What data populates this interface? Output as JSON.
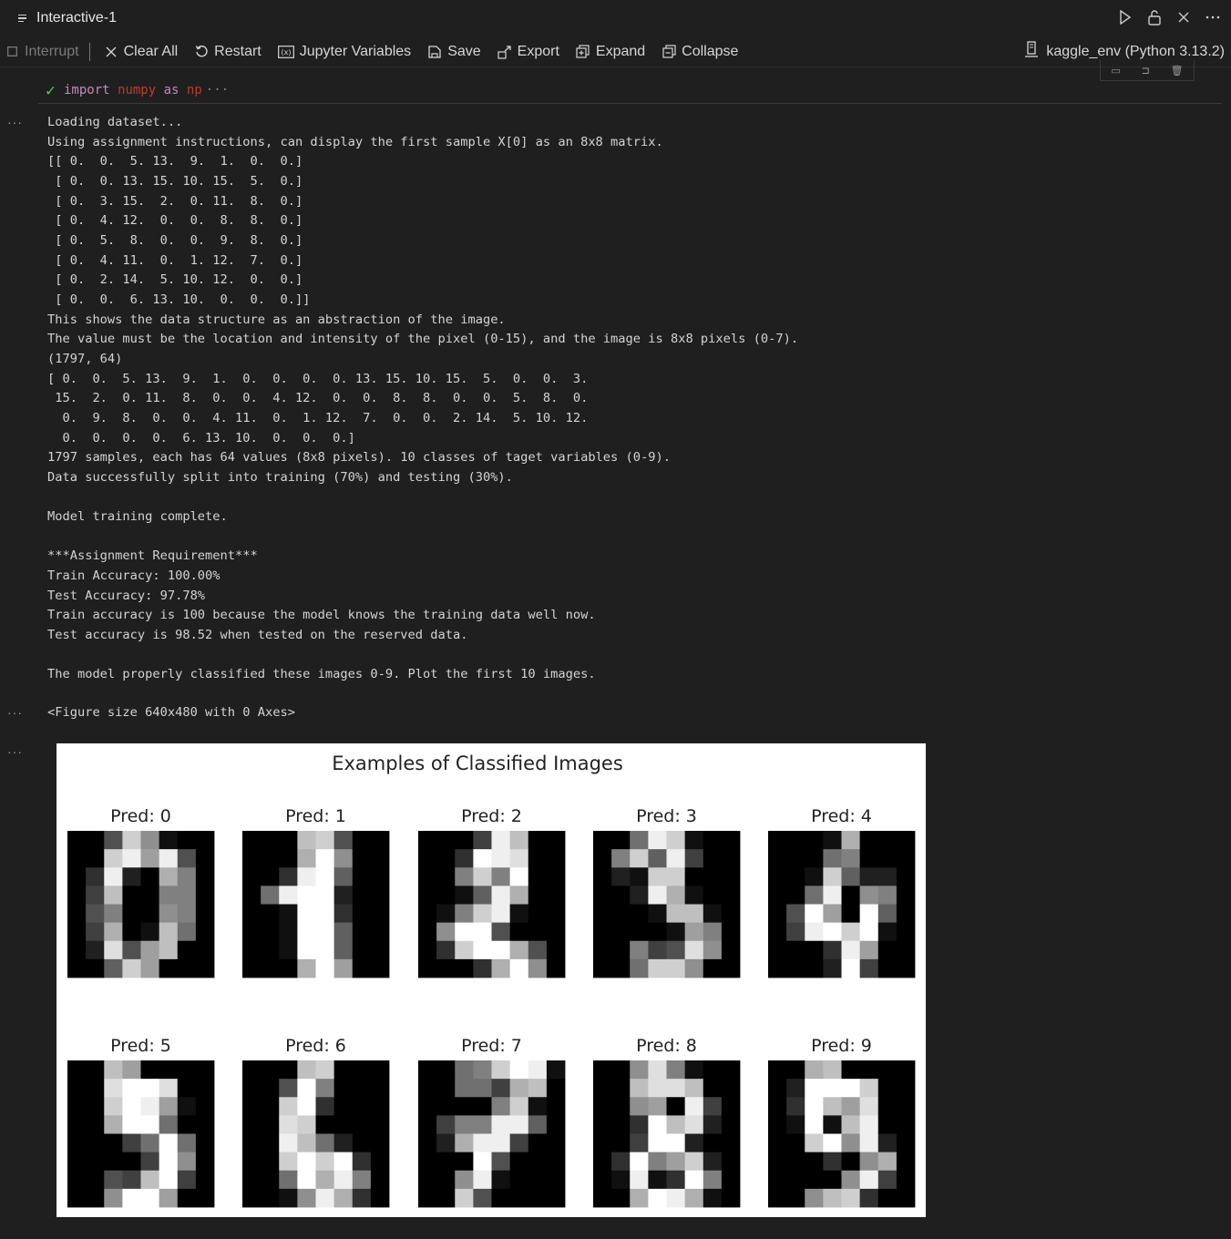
{
  "window": {
    "title": "Interactive-1"
  },
  "title_actions": [
    {
      "name": "run-icon",
      "glyph": "▷"
    },
    {
      "name": "lock-icon",
      "glyph": "🔓"
    },
    {
      "name": "close-icon",
      "glyph": "✕"
    },
    {
      "name": "more-icon",
      "glyph": "⋯"
    }
  ],
  "toolbar": {
    "interrupt": "Interrupt",
    "clear_all": "Clear All",
    "restart": "Restart",
    "variables": "Jupyter Variables",
    "save": "Save",
    "export": "Export",
    "expand": "Expand",
    "collapse": "Collapse",
    "kernel": "kaggle_env (Python 3.13.2)"
  },
  "cell": {
    "kw_import": "import",
    "module": "numpy",
    "kw_as": "as",
    "alias": "np",
    "ellipsis": "···"
  },
  "output_lines": [
    "Loading dataset...",
    "Using assignment instructions, can display the first sample X[0] as an 8x8 matrix.",
    "[[ 0.  0.  5. 13.  9.  1.  0.  0.]",
    " [ 0.  0. 13. 15. 10. 15.  5.  0.]",
    " [ 0.  3. 15.  2.  0. 11.  8.  0.]",
    " [ 0.  4. 12.  0.  0.  8.  8.  0.]",
    " [ 0.  5.  8.  0.  0.  9.  8.  0.]",
    " [ 0.  4. 11.  0.  1. 12.  7.  0.]",
    " [ 0.  2. 14.  5. 10. 12.  0.  0.]",
    " [ 0.  0.  6. 13. 10.  0.  0.  0.]]",
    "This shows the data structure as an abstraction of the image.",
    "The value must be the location and intensity of the pixel (0-15), and the image is 8x8 pixels (0-7).",
    "(1797, 64)",
    "[ 0.  0.  5. 13.  9.  1.  0.  0.  0.  0. 13. 15. 10. 15.  5.  0.  0.  3.",
    " 15.  2.  0. 11.  8.  0.  0.  4. 12.  0.  0.  8.  8.  0.  0.  5.  8.  0.",
    "  0.  9.  8.  0.  0.  4. 11.  0.  1. 12.  7.  0.  0.  2. 14.  5. 10. 12.",
    "  0.  0.  0.  0.  6. 13. 10.  0.  0.  0.]",
    "1797 samples, each has 64 values (8x8 pixels). 10 classes of taget variables (0-9).",
    "Data successfully split into training (70%) and testing (30%).",
    "",
    "Model training complete.",
    "",
    "***Assignment Requirement***",
    "Train Accuracy: 100.00%",
    "Test Accuracy: 97.78%",
    "Train accuracy is 100 because the model knows the training data well now.",
    "Test accuracy is 98.52 when tested on the reserved data.",
    "",
    "The model properly classified these images 0-9. Plot the first 10 images."
  ],
  "figure_text": "<Figure size 640x480 with 0 Axes>",
  "figure": {
    "title": "Examples of Classified Images",
    "panels": [
      {
        "label": "Pred: 0",
        "pixels": [
          [
            0,
            0,
            5,
            13,
            9,
            1,
            0,
            0
          ],
          [
            0,
            0,
            13,
            15,
            10,
            15,
            5,
            0
          ],
          [
            0,
            3,
            15,
            2,
            0,
            11,
            8,
            0
          ],
          [
            0,
            4,
            12,
            0,
            0,
            8,
            8,
            0
          ],
          [
            0,
            5,
            8,
            0,
            0,
            9,
            8,
            0
          ],
          [
            0,
            4,
            11,
            0,
            1,
            12,
            7,
            0
          ],
          [
            0,
            2,
            14,
            5,
            10,
            12,
            0,
            0
          ],
          [
            0,
            0,
            6,
            13,
            10,
            0,
            0,
            0
          ]
        ]
      },
      {
        "label": "Pred: 1",
        "pixels": [
          [
            0,
            0,
            0,
            12,
            13,
            5,
            0,
            0
          ],
          [
            0,
            0,
            0,
            11,
            16,
            9,
            0,
            0
          ],
          [
            0,
            0,
            3,
            15,
            16,
            6,
            0,
            0
          ],
          [
            0,
            7,
            15,
            16,
            16,
            2,
            0,
            0
          ],
          [
            0,
            0,
            1,
            16,
            16,
            3,
            0,
            0
          ],
          [
            0,
            0,
            1,
            16,
            16,
            6,
            0,
            0
          ],
          [
            0,
            0,
            1,
            16,
            16,
            6,
            0,
            0
          ],
          [
            0,
            0,
            0,
            11,
            16,
            10,
            0,
            0
          ]
        ]
      },
      {
        "label": "Pred: 2",
        "pixels": [
          [
            0,
            0,
            0,
            4,
            15,
            12,
            0,
            0
          ],
          [
            0,
            0,
            3,
            16,
            15,
            14,
            0,
            0
          ],
          [
            0,
            0,
            8,
            13,
            8,
            16,
            0,
            0
          ],
          [
            0,
            0,
            1,
            6,
            15,
            11,
            0,
            0
          ],
          [
            0,
            1,
            8,
            13,
            15,
            1,
            0,
            0
          ],
          [
            0,
            9,
            16,
            16,
            5,
            0,
            0,
            0
          ],
          [
            0,
            3,
            13,
            16,
            16,
            11,
            5,
            0
          ],
          [
            0,
            0,
            0,
            3,
            11,
            16,
            9,
            0
          ]
        ]
      },
      {
        "label": "Pred: 3",
        "pixels": [
          [
            0,
            0,
            7,
            15,
            13,
            1,
            0,
            0
          ],
          [
            0,
            8,
            13,
            6,
            15,
            4,
            0,
            0
          ],
          [
            0,
            2,
            1,
            13,
            13,
            0,
            0,
            0
          ],
          [
            0,
            0,
            2,
            15,
            11,
            1,
            0,
            0
          ],
          [
            0,
            0,
            0,
            1,
            12,
            12,
            1,
            0
          ],
          [
            0,
            0,
            0,
            0,
            1,
            10,
            8,
            0
          ],
          [
            0,
            0,
            8,
            4,
            5,
            14,
            9,
            0
          ],
          [
            0,
            0,
            7,
            13,
            13,
            9,
            0,
            0
          ]
        ]
      },
      {
        "label": "Pred: 4",
        "pixels": [
          [
            0,
            0,
            0,
            1,
            11,
            0,
            0,
            0
          ],
          [
            0,
            0,
            0,
            7,
            8,
            0,
            0,
            0
          ],
          [
            0,
            0,
            1,
            13,
            6,
            2,
            2,
            0
          ],
          [
            0,
            0,
            7,
            15,
            0,
            9,
            8,
            0
          ],
          [
            0,
            5,
            16,
            10,
            0,
            16,
            6,
            0
          ],
          [
            0,
            4,
            15,
            16,
            13,
            16,
            1,
            0
          ],
          [
            0,
            0,
            0,
            3,
            15,
            10,
            0,
            0
          ],
          [
            0,
            0,
            0,
            2,
            16,
            4,
            0,
            0
          ]
        ]
      },
      {
        "label": "Pred: 5",
        "pixels": [
          [
            0,
            0,
            12,
            10,
            0,
            0,
            0,
            0
          ],
          [
            0,
            0,
            14,
            16,
            16,
            14,
            0,
            0
          ],
          [
            0,
            0,
            13,
            16,
            15,
            10,
            1,
            0
          ],
          [
            0,
            0,
            11,
            16,
            16,
            7,
            0,
            0
          ],
          [
            0,
            0,
            0,
            4,
            7,
            16,
            7,
            0
          ],
          [
            0,
            0,
            0,
            0,
            4,
            16,
            9,
            0
          ],
          [
            0,
            0,
            5,
            4,
            12,
            16,
            4,
            0
          ],
          [
            0,
            0,
            9,
            16,
            16,
            10,
            0,
            0
          ]
        ]
      },
      {
        "label": "Pred: 6",
        "pixels": [
          [
            0,
            0,
            0,
            12,
            13,
            0,
            0,
            0
          ],
          [
            0,
            0,
            5,
            16,
            8,
            0,
            0,
            0
          ],
          [
            0,
            0,
            13,
            16,
            3,
            0,
            0,
            0
          ],
          [
            0,
            0,
            14,
            13,
            0,
            0,
            0,
            0
          ],
          [
            0,
            0,
            15,
            12,
            7,
            2,
            0,
            0
          ],
          [
            0,
            0,
            13,
            16,
            13,
            16,
            3,
            0
          ],
          [
            0,
            0,
            7,
            16,
            11,
            15,
            8,
            0
          ],
          [
            0,
            0,
            1,
            9,
            15,
            11,
            3,
            0
          ]
        ]
      },
      {
        "label": "Pred: 7",
        "pixels": [
          [
            0,
            0,
            7,
            8,
            13,
            16,
            15,
            1
          ],
          [
            0,
            0,
            7,
            7,
            4,
            11,
            12,
            0
          ],
          [
            0,
            0,
            0,
            0,
            8,
            13,
            1,
            0
          ],
          [
            0,
            4,
            8,
            8,
            15,
            15,
            6,
            0
          ],
          [
            0,
            2,
            11,
            15,
            15,
            4,
            0,
            0
          ],
          [
            0,
            0,
            0,
            16,
            5,
            0,
            0,
            0
          ],
          [
            0,
            0,
            9,
            15,
            1,
            0,
            0,
            0
          ],
          [
            0,
            0,
            13,
            5,
            0,
            0,
            0,
            0
          ]
        ]
      },
      {
        "label": "Pred: 8",
        "pixels": [
          [
            0,
            0,
            9,
            14,
            8,
            1,
            0,
            0
          ],
          [
            0,
            0,
            12,
            14,
            14,
            12,
            0,
            0
          ],
          [
            0,
            0,
            9,
            10,
            0,
            15,
            4,
            0
          ],
          [
            0,
            0,
            3,
            16,
            12,
            14,
            2,
            0
          ],
          [
            0,
            0,
            4,
            16,
            16,
            2,
            0,
            0
          ],
          [
            0,
            3,
            16,
            8,
            10,
            13,
            2,
            0
          ],
          [
            0,
            1,
            15,
            1,
            3,
            16,
            8,
            0
          ],
          [
            0,
            0,
            11,
            16,
            15,
            11,
            1,
            0
          ]
        ]
      },
      {
        "label": "Pred: 9",
        "pixels": [
          [
            0,
            0,
            11,
            12,
            0,
            0,
            0,
            0
          ],
          [
            0,
            2,
            16,
            16,
            16,
            13,
            0,
            0
          ],
          [
            0,
            3,
            16,
            12,
            10,
            14,
            0,
            0
          ],
          [
            0,
            1,
            16,
            1,
            12,
            15,
            0,
            0
          ],
          [
            0,
            0,
            13,
            16,
            9,
            15,
            2,
            0
          ],
          [
            0,
            0,
            0,
            3,
            0,
            9,
            11,
            0
          ],
          [
            0,
            0,
            0,
            0,
            9,
            15,
            4,
            0
          ],
          [
            0,
            0,
            9,
            12,
            13,
            3,
            0,
            0
          ]
        ]
      }
    ]
  },
  "colors": {
    "background": "#1f1f1f",
    "check": "#4ec94e",
    "keyword": "#c586c0",
    "module": "#c0392b"
  }
}
